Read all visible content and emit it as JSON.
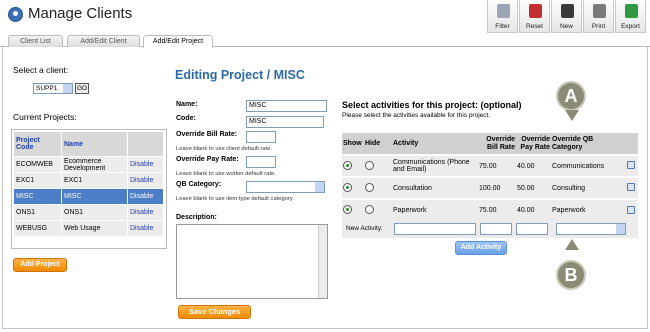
{
  "header": {
    "title": "Manage Clients"
  },
  "toolbar": [
    {
      "label": "Filter",
      "icon": "filter-icon",
      "color": "#9aa5b5"
    },
    {
      "label": "Reset",
      "icon": "reset-icon",
      "color": "#c03030"
    },
    {
      "label": "New",
      "icon": "new-person-icon",
      "color": "#3a3a3a"
    },
    {
      "label": "Print",
      "icon": "printer-icon",
      "color": "#7a7a7a"
    },
    {
      "label": "Export",
      "icon": "export-icon",
      "color": "#2f9a3f"
    }
  ],
  "tabs": [
    "Client List",
    "Add/Edit Client",
    "Add/Edit Project"
  ],
  "left": {
    "select_label": "Select a client:",
    "client_value": "SUPP1",
    "go_label": "GO",
    "projects_label": "Current Projects:",
    "columns": [
      "Project Code",
      "Name",
      ""
    ],
    "projects": [
      {
        "code": "ECOMWEB",
        "name": "Ecommerce Development",
        "action": "Disable"
      },
      {
        "code": "EXC1",
        "name": "EXC1",
        "action": "Disable"
      },
      {
        "code": "MISC",
        "name": "MISC",
        "action": "Disable"
      },
      {
        "code": "ONS1",
        "name": "ONS1",
        "action": "Disable"
      },
      {
        "code": "WEBUSG",
        "name": "Web Usage",
        "action": "Disable"
      }
    ],
    "add_project_label": "Add Project"
  },
  "form": {
    "title": "Editing Project / MISC",
    "name_label": "Name:",
    "name_value": "MISC",
    "code_label": "Code:",
    "code_value": "MISC",
    "bill_label": "Override Bill Rate:",
    "bill_hint": "Leave blank to use client default rate.",
    "pay_label": "Override Pay Rate:",
    "pay_hint": "Leave blank to use worker default rate.",
    "qb_label": "QB Category:",
    "qb_hint": "Leave blank to use item type default category.",
    "desc_label": "Description:",
    "save_label": "Save Changes"
  },
  "activities": {
    "heading": "Select activities for this project: (optional)",
    "subheading": "Please select the activities available for this project.",
    "columns": [
      "Show",
      "Hide",
      "Activity",
      "Override Bill Rate",
      "Override Pay Rate",
      "Override QB Category"
    ],
    "rows": [
      {
        "activity": "Communications (Phone and Email)",
        "bill": "75.00",
        "pay": "40.00",
        "qb": "Communications"
      },
      {
        "activity": "Consultation",
        "bill": "100.00",
        "pay": "50.00",
        "qb": "Consulting"
      },
      {
        "activity": "Paperwork",
        "bill": "75.00",
        "pay": "40.00",
        "qb": "Paperwork"
      }
    ],
    "new_label": "New Activity:",
    "add_label": "Add Activity"
  },
  "callouts": [
    "A",
    "B"
  ]
}
